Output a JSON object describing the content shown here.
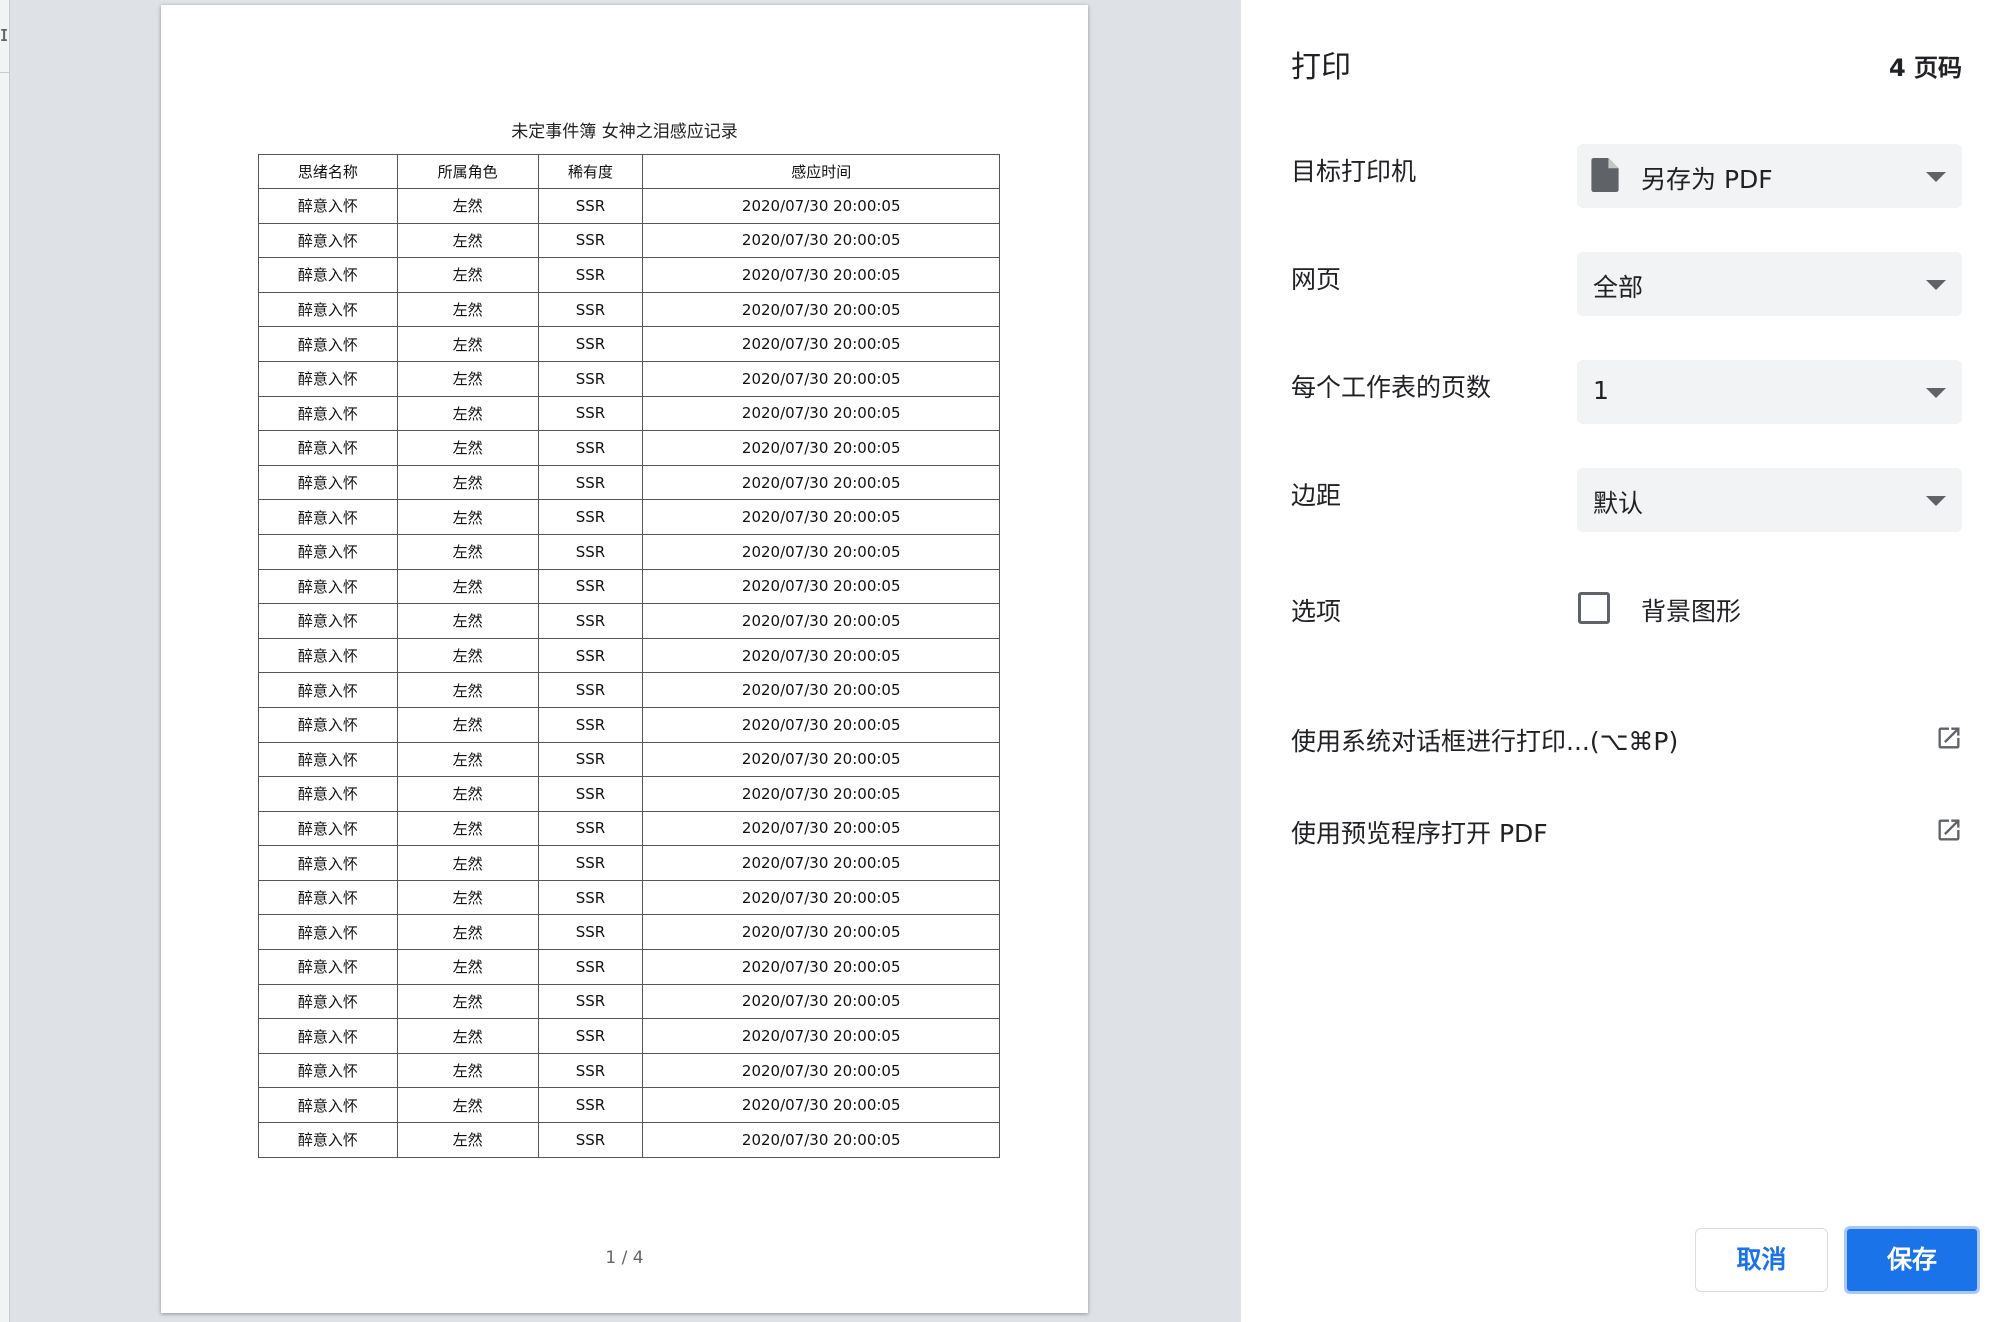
{
  "preview": {
    "document_title": "未定事件簿 女神之泪感应记录",
    "columns": [
      "思绪名称",
      "所属角色",
      "稀有度",
      "感应时间"
    ],
    "rows": [
      [
        "醉意入怀",
        "左然",
        "SSR",
        "2020/07/30 20:00:05"
      ],
      [
        "醉意入怀",
        "左然",
        "SSR",
        "2020/07/30 20:00:05"
      ],
      [
        "醉意入怀",
        "左然",
        "SSR",
        "2020/07/30 20:00:05"
      ],
      [
        "醉意入怀",
        "左然",
        "SSR",
        "2020/07/30 20:00:05"
      ],
      [
        "醉意入怀",
        "左然",
        "SSR",
        "2020/07/30 20:00:05"
      ],
      [
        "醉意入怀",
        "左然",
        "SSR",
        "2020/07/30 20:00:05"
      ],
      [
        "醉意入怀",
        "左然",
        "SSR",
        "2020/07/30 20:00:05"
      ],
      [
        "醉意入怀",
        "左然",
        "SSR",
        "2020/07/30 20:00:05"
      ],
      [
        "醉意入怀",
        "左然",
        "SSR",
        "2020/07/30 20:00:05"
      ],
      [
        "醉意入怀",
        "左然",
        "SSR",
        "2020/07/30 20:00:05"
      ],
      [
        "醉意入怀",
        "左然",
        "SSR",
        "2020/07/30 20:00:05"
      ],
      [
        "醉意入怀",
        "左然",
        "SSR",
        "2020/07/30 20:00:05"
      ],
      [
        "醉意入怀",
        "左然",
        "SSR",
        "2020/07/30 20:00:05"
      ],
      [
        "醉意入怀",
        "左然",
        "SSR",
        "2020/07/30 20:00:05"
      ],
      [
        "醉意入怀",
        "左然",
        "SSR",
        "2020/07/30 20:00:05"
      ],
      [
        "醉意入怀",
        "左然",
        "SSR",
        "2020/07/30 20:00:05"
      ],
      [
        "醉意入怀",
        "左然",
        "SSR",
        "2020/07/30 20:00:05"
      ],
      [
        "醉意入怀",
        "左然",
        "SSR",
        "2020/07/30 20:00:05"
      ],
      [
        "醉意入怀",
        "左然",
        "SSR",
        "2020/07/30 20:00:05"
      ],
      [
        "醉意入怀",
        "左然",
        "SSR",
        "2020/07/30 20:00:05"
      ],
      [
        "醉意入怀",
        "左然",
        "SSR",
        "2020/07/30 20:00:05"
      ],
      [
        "醉意入怀",
        "左然",
        "SSR",
        "2020/07/30 20:00:05"
      ],
      [
        "醉意入怀",
        "左然",
        "SSR",
        "2020/07/30 20:00:05"
      ],
      [
        "醉意入怀",
        "左然",
        "SSR",
        "2020/07/30 20:00:05"
      ],
      [
        "醉意入怀",
        "左然",
        "SSR",
        "2020/07/30 20:00:05"
      ],
      [
        "醉意入怀",
        "左然",
        "SSR",
        "2020/07/30 20:00:05"
      ],
      [
        "醉意入怀",
        "左然",
        "SSR",
        "2020/07/30 20:00:05"
      ],
      [
        "醉意入怀",
        "左然",
        "SSR",
        "2020/07/30 20:00:05"
      ]
    ],
    "page_indicator": "1 / 4"
  },
  "panel": {
    "title": "打印",
    "page_count": "4 页码",
    "destination": {
      "label": "目标打印机",
      "value": "另存为 PDF",
      "icon": "file-icon"
    },
    "pages": {
      "label": "网页",
      "value": "全部"
    },
    "pages_per_sheet": {
      "label": "每个工作表的页数",
      "value": "1"
    },
    "margins": {
      "label": "边距",
      "value": "默认"
    },
    "options": {
      "label": "选项",
      "checkbox_label": "背景图形",
      "checked": false
    },
    "system_dialog_link": "使用系统对话框进行打印...(⌥⌘P)",
    "open_preview_link": "使用预览程序打开 PDF",
    "cancel_label": "取消",
    "save_label": "保存"
  },
  "colors": {
    "accent": "#1a73e8",
    "preview_background": "#dee1e6",
    "select_background": "#f1f3f4"
  }
}
